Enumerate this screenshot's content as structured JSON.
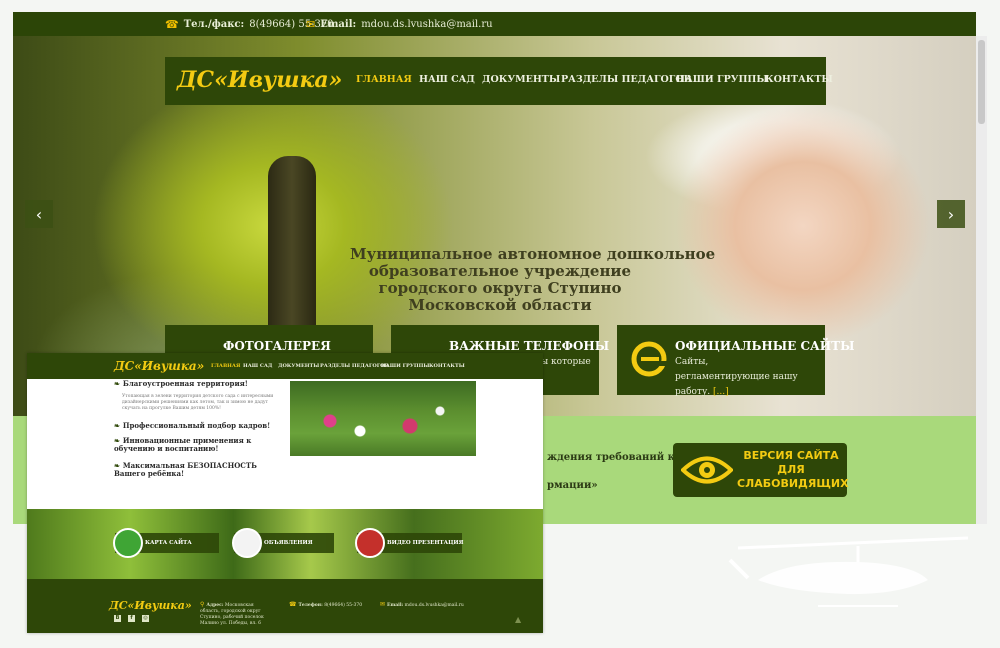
{
  "topbar": {
    "phone_label": "Тел./факс:",
    "phone_value": "8(49664) 55-370",
    "email_label": "Email:",
    "email_value": "mdou.ds.lvushka@mail.ru"
  },
  "header": {
    "logo": "ДС«Ивушка»",
    "nav": [
      "ГЛАВНАЯ",
      "НАШ САД",
      "ДОКУМЕНТЫ",
      "РАЗДЕЛЫ ПЕДАГОГОВ",
      "НАШИ ГРУППЫ",
      "КОНТАКТЫ"
    ]
  },
  "hero": {
    "arrow_left": "‹",
    "arrow_right": "›",
    "lines": [
      "Муниципальное автономное дошкольное",
      "образовательное учреждение",
      "городского округа Ступино",
      "Московской области"
    ]
  },
  "cards": [
    {
      "title": "ФОТОГАЛЕРЕЯ",
      "text": ""
    },
    {
      "title": "ВАЖНЫЕ ТЕЛЕФОНЫ",
      "text": "ы которые"
    },
    {
      "title": "ОФИЦИАЛЬНЫЕ САЙТЫ",
      "text": "Сайты, регламентирующие нашу работу.",
      "more": "[...]"
    }
  ],
  "band": {
    "text1": "ждения требований к",
    "text2": "рмации»"
  },
  "vision_button": "ВЕРСИЯ САЙТА ДЛЯ СЛАБОВИДЯЩИХ",
  "inset": {
    "logo": "ДС«Ивушка»",
    "nav": [
      "ГЛАВНАЯ",
      "НАШ САД",
      "ДОКУМЕНТЫ",
      "РАЗДЕЛЫ ПЕДАГОГОВ",
      "НАШИ ГРУППЫ",
      "КОНТАКТЫ"
    ],
    "features": [
      "Благоустроенная территория!",
      "Профессиональный подбор кадров!",
      "Инновационные применения к обучению и воспитанию!",
      "Максимальная БЕЗОПАСНОСТЬ Вашего ребёнка!"
    ],
    "feature_desc": "Утопающая в зелени территория детского сада с интересными дизайнерскими решениями как летом, так и зимою не дадут скучать на прогулке Вашим детям 100%!",
    "boxes": [
      "КАРТА САЙТА",
      "ОБЪЯВЛЕНИЯ",
      "ВИДЕО ПРЕЗЕНТАЦИЯ"
    ],
    "footer": {
      "logo": "ДС«Ивушка»",
      "address_label": "Адрес:",
      "address_value": "Московская область, городской округ Ступино, рабочий поселок Малино ул. Победы, вл. 6",
      "phone_label": "Телефон:",
      "phone_value": "8(49664) 55-370",
      "email_label": "Email:",
      "email_value": "mdou.ds.lvushka@mail.ru"
    }
  }
}
